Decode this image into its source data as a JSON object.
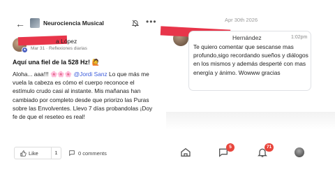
{
  "group": {
    "name": "Neurociencia Musical"
  },
  "post": {
    "author_name_visible": "a López",
    "meta": "Mar 31 · Reflexiones diarias",
    "title": "Aquí una fiel de la 528 Hz! 🙋",
    "body_parts": {
      "intro": "Aloha... aaa!!! 🌸🌸🌸 ",
      "mention": "@Jordi Sanz",
      "rest": " Lo que más me vuela la cabeza es cómo el cuerpo reconoce el estímulo crudo casi al instante. Mis mañanas han cambiado por completo desde que priorizo las Puras sobre las Envolventes. Llevo 7 días probandolas ¡Doy fe de que el reseteo es real!"
    },
    "like_label": "Like",
    "like_count": "1",
    "comments_label": "0 comments"
  },
  "chat": {
    "date": "Apr 30th 2026",
    "sender_visible": "Hernández",
    "time": "1:02pm",
    "message": "Te quiero comentar que sescanse mas profundo,sigo recordando sueños y diálogos en los mismos y además desperté con mas energía y ánimo. Wowww gracias"
  },
  "nav": {
    "chat_badge": "5",
    "notifications_badge": "71"
  },
  "colors": {
    "accent": "#3b5bdb",
    "redaction": "#e8354a",
    "badge": "#e8453c"
  },
  "icons": [
    "back-arrow-icon",
    "group-avatar",
    "bell-icon",
    "more-icon",
    "like-icon",
    "comment-icon",
    "home-icon",
    "chat-icon",
    "notification-bell-icon",
    "profile-avatar"
  ]
}
